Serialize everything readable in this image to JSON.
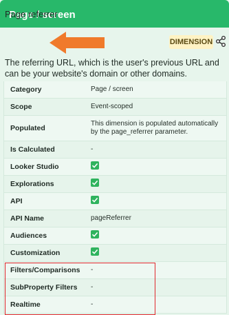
{
  "header": {
    "title": "Page / screen"
  },
  "dimension": {
    "name": "Page referrer",
    "badge": "DIMENSION",
    "share_icon": "share-icon",
    "description": "The referring URL, which is the user's previous URL and can be your website's domain or other domains."
  },
  "annotation": {
    "arrow_color": "#f07a2b",
    "box_color": "#e0262b"
  },
  "rows": [
    {
      "label": "Category",
      "value": "Page / screen",
      "type": "text"
    },
    {
      "label": "Scope",
      "value": "Event-scoped",
      "type": "text"
    },
    {
      "label": "Populated",
      "value": "This dimension is populated automatically by the page_referrer parameter.",
      "type": "text"
    },
    {
      "label": "Is Calculated",
      "value": "-",
      "type": "text"
    },
    {
      "label": "Looker Studio",
      "value": "",
      "type": "check"
    },
    {
      "label": "Explorations",
      "value": "",
      "type": "check"
    },
    {
      "label": "API",
      "value": "",
      "type": "check"
    },
    {
      "label": "API Name",
      "value": "pageReferrer",
      "type": "text"
    },
    {
      "label": "Audiences",
      "value": "",
      "type": "check"
    },
    {
      "label": "Customization",
      "value": "",
      "type": "check"
    },
    {
      "label": "Filters/Comparisons",
      "value": "-",
      "type": "text"
    },
    {
      "label": "SubProperty Filters",
      "value": "-",
      "type": "text"
    },
    {
      "label": "Realtime",
      "value": "-",
      "type": "text"
    }
  ]
}
